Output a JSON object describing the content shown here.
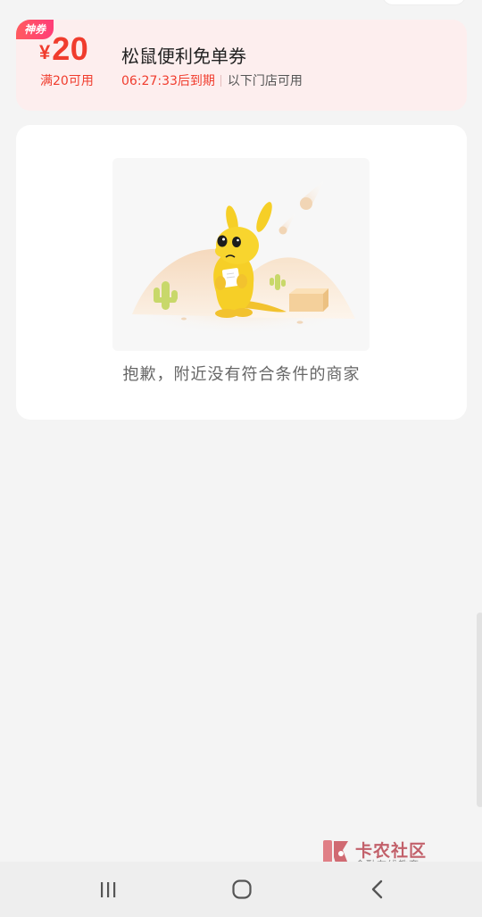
{
  "coupon": {
    "tag": "神券",
    "currency": "¥",
    "amount": "20",
    "condition": "满20可用",
    "title": "松鼠便利免单券",
    "expire": "06:27:33后到期",
    "store_scope": "以下门店可用"
  },
  "empty_state": {
    "message": "抱歉，附近没有符合条件的商家"
  },
  "watermark": {
    "title": "卡农社区",
    "subtitle": "金融在线教育"
  },
  "nav": {
    "recents_icon": "recents-icon",
    "home_icon": "home-icon",
    "back_icon": "back-icon"
  },
  "colors": {
    "accent": "#f03c2d",
    "coupon_bg": "#fdeeee",
    "page_bg": "#f4f4f4"
  }
}
